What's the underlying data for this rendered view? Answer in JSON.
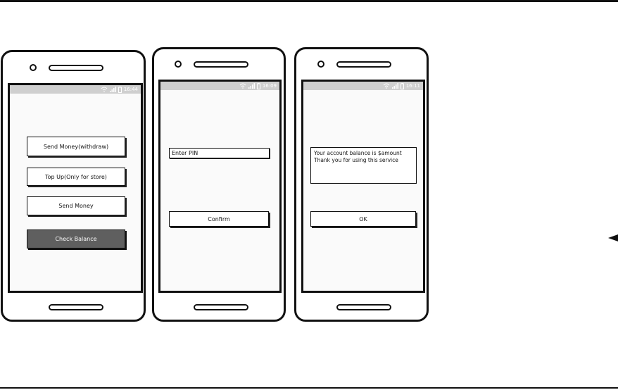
{
  "phones": [
    {
      "status": {
        "time": "16:44"
      },
      "buttons": {
        "send_withdraw": "Send Money(withdraw)",
        "topup": "Top Up(Only for store)",
        "send_money": "Send Money",
        "check_balance": "Check Balance"
      }
    },
    {
      "status": {
        "time": "16:09"
      },
      "pin_placeholder": "Enter PIN",
      "confirm": "Confirm"
    },
    {
      "status": {
        "time": "16:11"
      },
      "message": {
        "line1": "Your account balance is $amount",
        "line2": "Thank you for using this service"
      },
      "ok": "OK"
    }
  ],
  "colors": {
    "outline": "#111111",
    "statusbar": "#cfcfcf",
    "screen_bg": "#fafafa",
    "primary_button": "#5f5f5f"
  },
  "icons": [
    "wifi-icon",
    "signal-icon",
    "battery-icon",
    "arrow-left-icon"
  ]
}
